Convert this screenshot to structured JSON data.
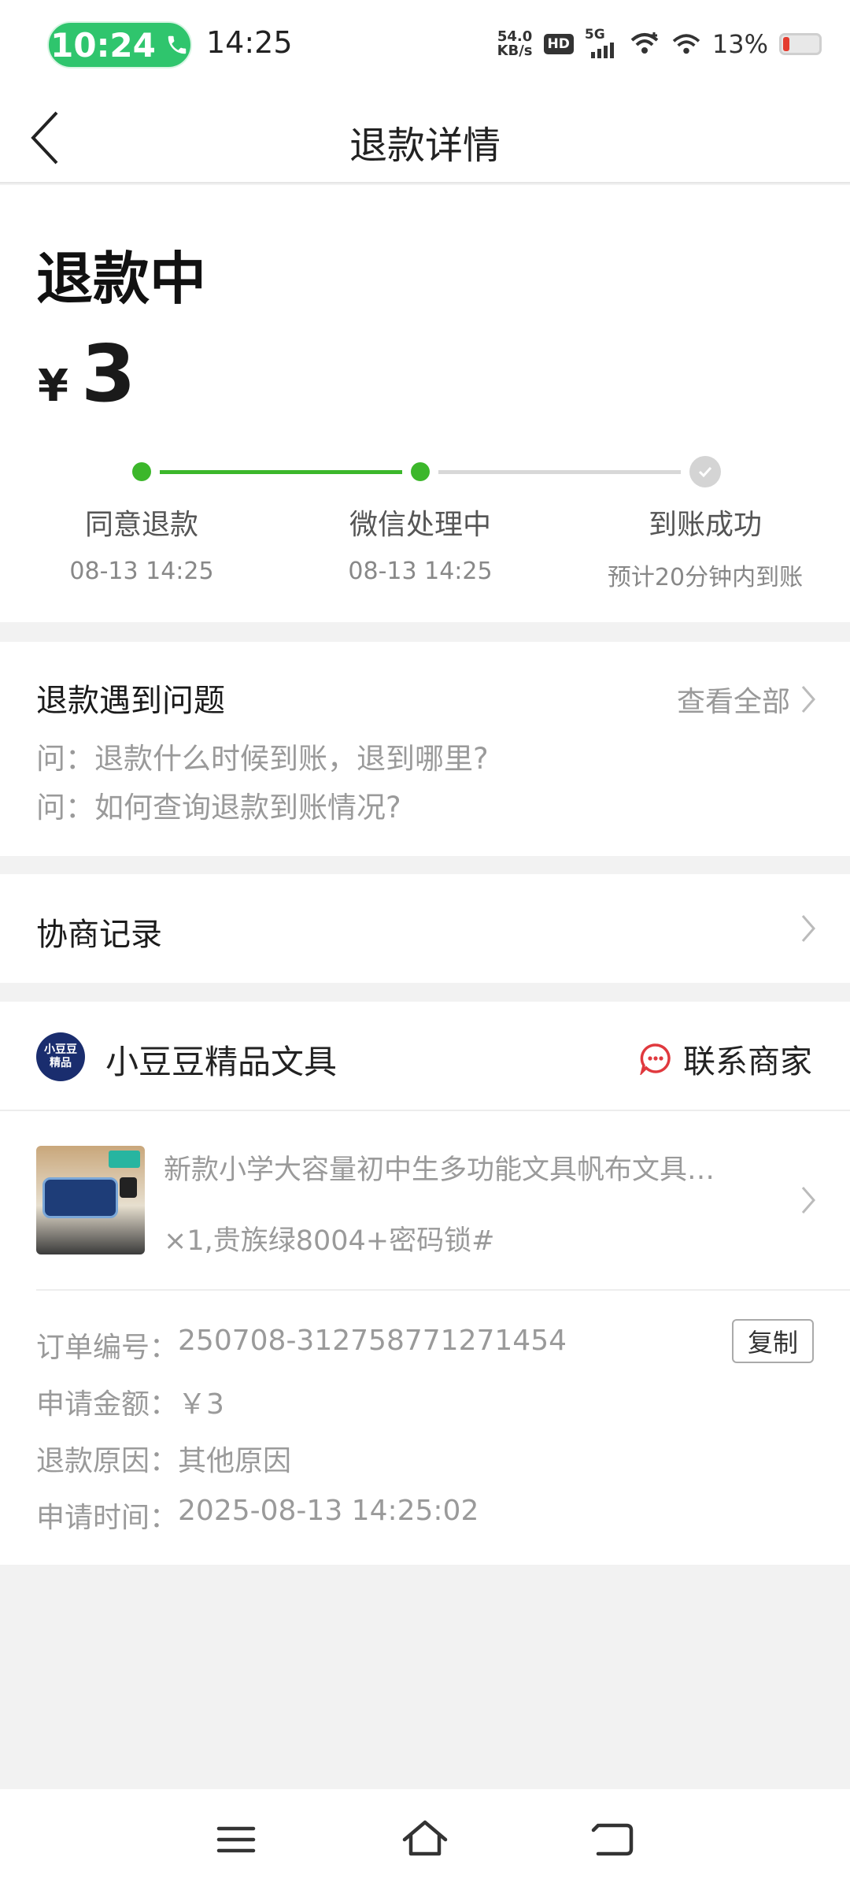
{
  "status_bar": {
    "call_time": "10:24",
    "time": "14:25",
    "speed_value": "54.0",
    "speed_unit": "KB/s",
    "hd": "HD",
    "network": "5G",
    "battery": "13%"
  },
  "header": {
    "title": "退款详情"
  },
  "refund": {
    "status": "退款中",
    "currency": "¥",
    "amount": "3",
    "steps": [
      {
        "label": "同意退款",
        "time": "08-13 14:25"
      },
      {
        "label": "微信处理中",
        "time": "08-13 14:25"
      },
      {
        "label": "到账成功",
        "time": "预计20分钟内到账"
      }
    ]
  },
  "problems": {
    "title": "退款遇到问题",
    "view_all": "查看全部",
    "faqs": [
      "问：退款什么时候到账，退到哪里?",
      "问：如何查询退款到账情况?"
    ]
  },
  "negotiation": {
    "title": "协商记录"
  },
  "merchant": {
    "avatar_line1": "小豆豆",
    "avatar_line2": "精品",
    "name": "小豆豆精品文具",
    "contact": "联系商家",
    "product_title": "新款小学大容量初中生多功能文具帆布文具…",
    "product_spec": "×1,贵族绿8004+密码锁#"
  },
  "order_info": {
    "order_no_label": "订单编号：",
    "order_no": "250708-312758771271454",
    "copy": "复制",
    "amount_label": "申请金额：",
    "amount": "￥3",
    "reason_label": "退款原因：",
    "reason": "其他原因",
    "time_label": "申请时间：",
    "time": "2025-08-13 14:25:02"
  },
  "colors": {
    "accent_green": "#3cb72b",
    "call_green": "#2fc56d",
    "contact_red": "#e0393e",
    "background": "#f2f2f2"
  }
}
